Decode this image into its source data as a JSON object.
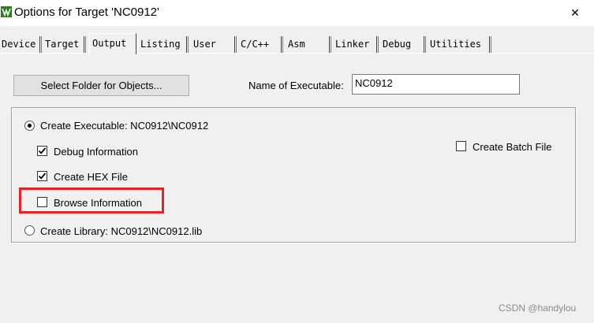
{
  "window": {
    "title": "Options for Target 'NC0912'",
    "icon": "keil-uvision-icon",
    "close_glyph": "✕"
  },
  "tabs": [
    {
      "label": "Device",
      "active": false
    },
    {
      "label": "Target",
      "active": false
    },
    {
      "label": "Output",
      "active": true
    },
    {
      "label": "Listing",
      "active": false
    },
    {
      "label": "User",
      "active": false
    },
    {
      "label": "C/C++",
      "active": false
    },
    {
      "label": "Asm",
      "active": false
    },
    {
      "label": "Linker",
      "active": false
    },
    {
      "label": "Debug",
      "active": false
    },
    {
      "label": "Utilities",
      "active": false
    }
  ],
  "output": {
    "select_folder_label": "Select Folder for Objects...",
    "name_of_executable_label": "Name of Executable:",
    "name_of_executable_value": "NC0912",
    "create_executable_label": "Create Executable:  NC0912\\NC0912",
    "create_executable_selected": true,
    "debug_information_label": "Debug Information",
    "debug_information_checked": true,
    "create_hex_label": "Create HEX File",
    "create_hex_checked": true,
    "browse_information_label": "Browse Information",
    "browse_information_checked": false,
    "create_library_label": "Create Library:  NC0912\\NC0912.lib",
    "create_library_selected": false,
    "create_batch_label": "Create Batch File",
    "create_batch_checked": false
  },
  "annotation": {
    "highlight_color": "#e0252a"
  },
  "watermark": "CSDN @handylou"
}
